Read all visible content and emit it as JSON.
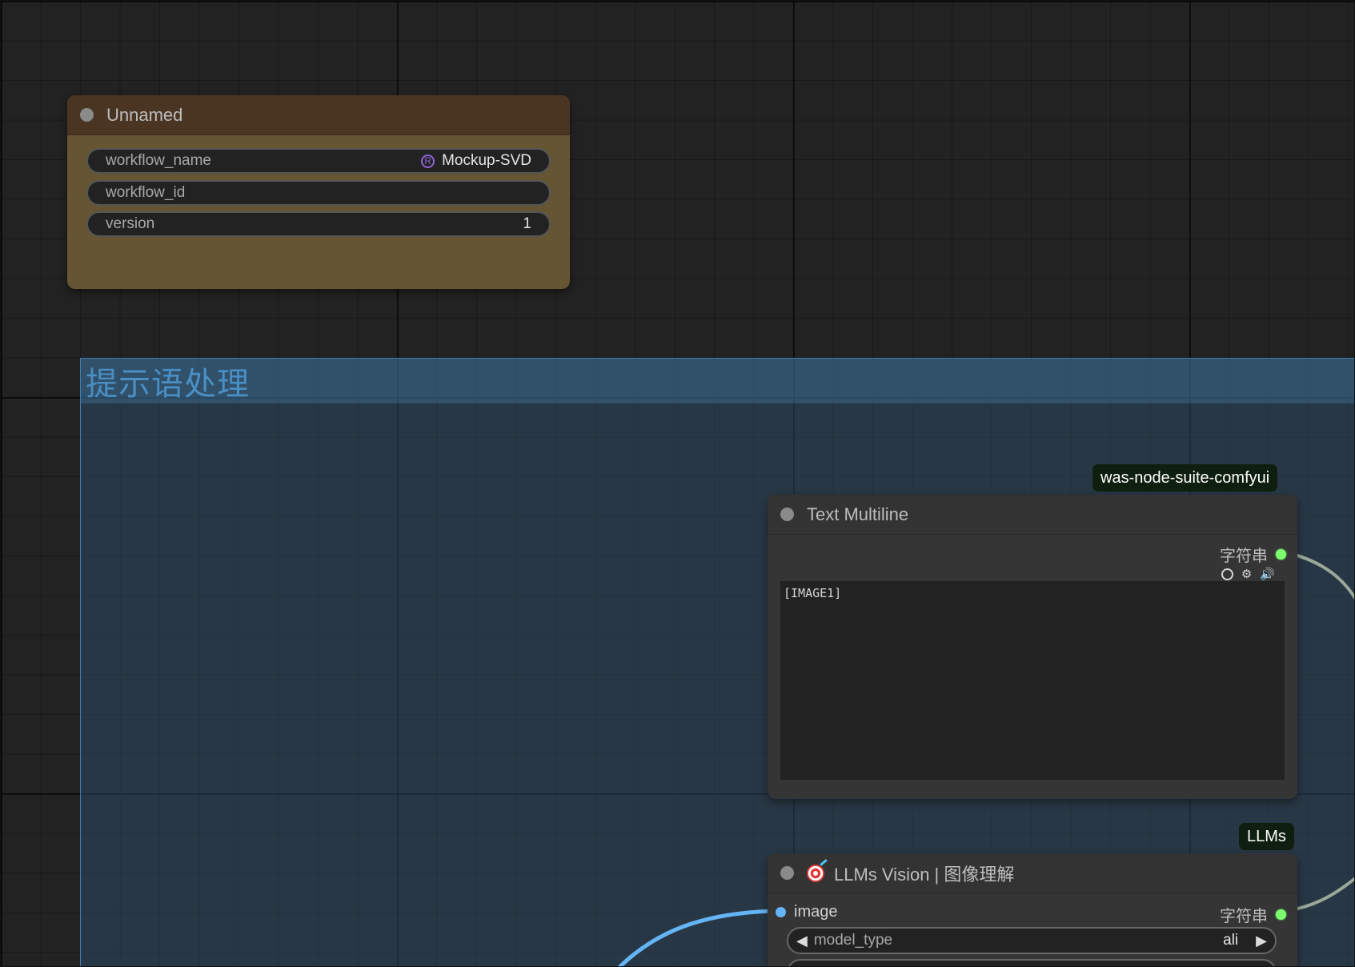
{
  "group": {
    "title": "提示语处理"
  },
  "unnamed_node": {
    "title": "Unnamed",
    "widgets": [
      {
        "label": "workflow_name",
        "value": "Mockup-SVD",
        "badge": "R"
      },
      {
        "label": "workflow_id",
        "value": ""
      },
      {
        "label": "version",
        "value": "1"
      }
    ]
  },
  "text_multiline_node": {
    "source": "was-node-suite-comfyui",
    "title": "Text Multiline",
    "output_label": "字符串",
    "text_value": "[IMAGE1]",
    "icons": [
      "circle-icon",
      "gear-icon",
      "speaker-icon"
    ]
  },
  "llms_node": {
    "source": "LLMs",
    "title": "LLMs Vision | 图像理解",
    "icon": "target-icon",
    "input_label": "image",
    "output_label": "字符串",
    "combos": [
      {
        "label": "model_type",
        "value": "ali"
      }
    ]
  },
  "colors": {
    "canvas": "#222222",
    "group": "#335577",
    "unnamed_node": "#665533",
    "node": "#353535",
    "string_slot": "#7cff6f",
    "image_slot": "#64b5f6",
    "string_link": "#9aa89a",
    "image_link": "#64b5f6"
  }
}
